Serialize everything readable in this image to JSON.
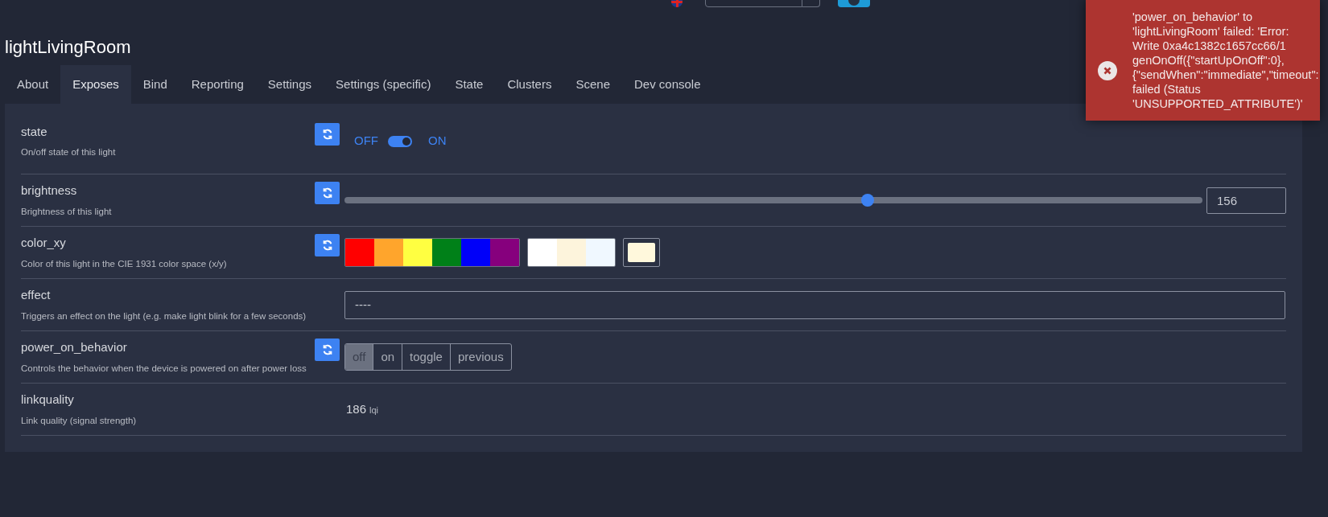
{
  "device_title": "lightLivingRoom",
  "tabs": [
    {
      "label": "About",
      "selected": false
    },
    {
      "label": "Exposes",
      "selected": true
    },
    {
      "label": "Bind",
      "selected": false
    },
    {
      "label": "Reporting",
      "selected": false
    },
    {
      "label": "Settings",
      "selected": false
    },
    {
      "label": "Settings (specific)",
      "selected": false
    },
    {
      "label": "State",
      "selected": false
    },
    {
      "label": "Clusters",
      "selected": false
    },
    {
      "label": "Scene",
      "selected": false
    },
    {
      "label": "Dev console",
      "selected": false
    }
  ],
  "exposes": [
    {
      "kind": "binary",
      "name": "state",
      "description": "On/off state of this light",
      "refresh": true,
      "off_label": "OFF",
      "on_label": "ON",
      "on": true
    },
    {
      "kind": "numeric",
      "name": "brightness",
      "description": "Brightness of this light",
      "refresh": true,
      "level": 0.61,
      "value": "156"
    },
    {
      "kind": "color",
      "name": "color_xy",
      "description": "Color of this light in the CIE 1931 color space (x/y)",
      "refresh": true,
      "presets": [
        {
          "color": "#ff0000"
        },
        {
          "color": "#ffa52c"
        },
        {
          "color": "#ffff41"
        },
        {
          "color": "#008018"
        },
        {
          "color": "#0000f9"
        },
        {
          "color": "#86007d"
        }
      ],
      "whites": [
        {
          "color": "#ffffff"
        },
        {
          "color": "#fdf4dc"
        },
        {
          "color": "#f0f8ff"
        }
      ],
      "current": {
        "color": "#fff8dc"
      }
    },
    {
      "kind": "select",
      "name": "effect",
      "description": "Triggers an effect on the light (e.g. make light blink for a few seconds)",
      "refresh": false,
      "value": "----"
    },
    {
      "kind": "enum",
      "name": "power_on_behavior",
      "description": "Controls the behavior when the device is powered on after power loss",
      "refresh": true,
      "options": [
        {
          "label": "off",
          "selected": true
        },
        {
          "label": "on",
          "selected": false
        },
        {
          "label": "toggle",
          "selected": false
        },
        {
          "label": "previous",
          "selected": false
        }
      ]
    },
    {
      "kind": "value",
      "name": "linkquality",
      "description": "Link quality (signal strength)",
      "refresh": false,
      "value": "186",
      "unit": "lqi"
    }
  ],
  "toast": {
    "kind": "error",
    "lines": [
      "'power_on_behavior' to",
      "'lightLivingRoom' failed: 'Error:",
      "Write 0xa4c1382c1657cc66/1",
      "genOnOff({\"startUpOnOff\":0},",
      "{\"sendWhen\":\"immediate\",\"timeout\":",
      "failed (Status",
      "'UNSUPPORTED_ATTRIBUTE')'"
    ]
  }
}
